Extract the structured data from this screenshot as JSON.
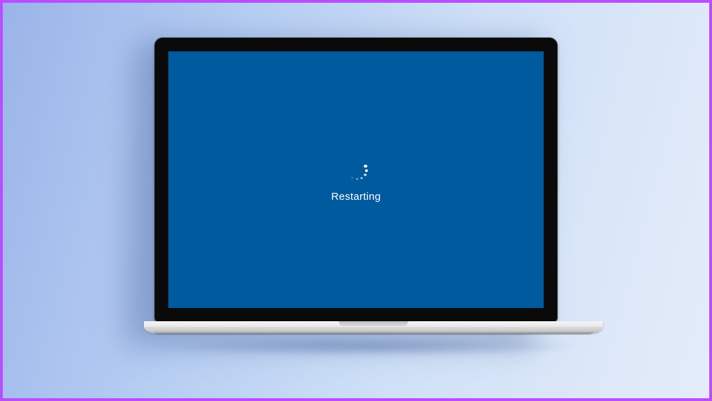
{
  "screen": {
    "status_message": "Restarting",
    "background_color": "#005a9e"
  },
  "frame": {
    "border_color": "#b94dff"
  }
}
